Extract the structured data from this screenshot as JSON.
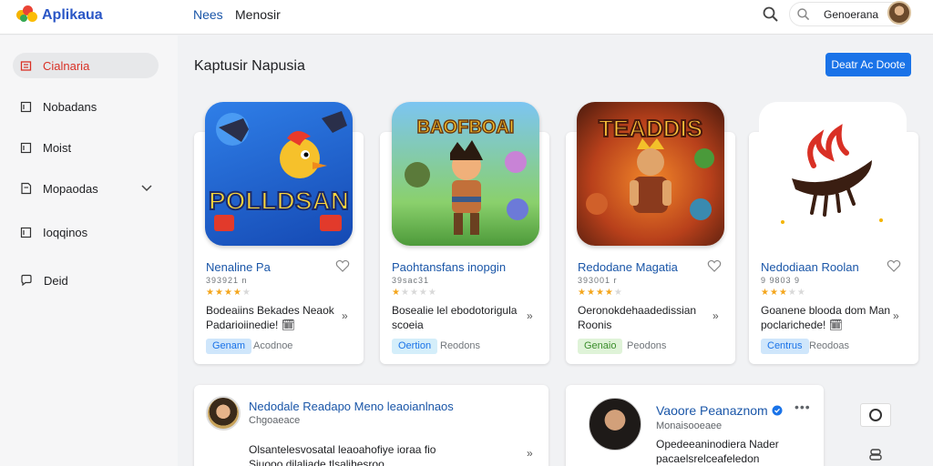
{
  "app": {
    "name": "Aplikaua",
    "brand_color": "#2a56c6"
  },
  "header": {
    "nav": [
      "Nees",
      "Menosir"
    ],
    "search_placeholder": "Genoerana"
  },
  "sidebar": {
    "items": [
      {
        "label": "Cialnaria",
        "icon": "home-icon",
        "active": true
      },
      {
        "label": "Nobadans",
        "icon": "bookmark-icon"
      },
      {
        "label": "Moist",
        "icon": "bookmark-icon"
      },
      {
        "label": "Mopaodas",
        "icon": "tag-icon",
        "expandable": true
      },
      {
        "label": "Ioqqinos",
        "icon": "bookmark-icon"
      },
      {
        "label": "Deid",
        "icon": "chat-icon"
      }
    ]
  },
  "main": {
    "title": "Kaptusir Napusia",
    "primary_button": "Deatr Ac Doote"
  },
  "cards": [
    {
      "art_title": "POLLDSAN",
      "title": "Nenaline Pa",
      "meta": "393921 n",
      "rating": 4,
      "desc": "Bodeaiins Bekades Neaok Padarioiinedie! 🗓",
      "chip": "Genam",
      "chip_bg": "#cfe6fb",
      "chip_color": "#1a73e8",
      "side": "Acodnoe"
    },
    {
      "art_title": "BAOFBOAI",
      "title": "Paohtansfans inopgin",
      "meta": "39sac31",
      "rating": 1,
      "desc": "Bosealie lel ebodotorigula scoeia",
      "chip": "Oertion",
      "chip_bg": "#d4eefa",
      "chip_color": "#1a73e8",
      "side": "Reodons"
    },
    {
      "art_title": "TEADDIS",
      "title": "Redodane Magatia",
      "meta": "393001 r",
      "rating": 4,
      "desc": "Oeronokdehaadedissian Roonis",
      "chip": "Genaio",
      "chip_bg": "#dff3d8",
      "chip_color": "#3b8d2c",
      "side": "Peodons"
    },
    {
      "art_title": "",
      "title": "Nedodiaan Roolan",
      "meta": "9 9803 9",
      "rating": 3,
      "desc": "Goanene blooda dom Man poclarichede! 🗓",
      "chip": "Centrus",
      "chip_bg": "#cfe6fb",
      "chip_color": "#1a73e8",
      "side": "Reodoas"
    }
  ],
  "posts": [
    {
      "name": "Nedodale Readapo Meno leaoianlnaos",
      "sub": "Chgoaeace",
      "text": [
        "Olsantelesvosatal leaoahofiye ioraa fio",
        "Siuooo dilaliade tlsalihesroo"
      ]
    },
    {
      "name": "Vaoore Peanaznom",
      "sub": "Monaisooeaee",
      "text": [
        "Opedeeaninodiera Nader",
        "pacaelsrelceafeledon"
      ]
    }
  ]
}
